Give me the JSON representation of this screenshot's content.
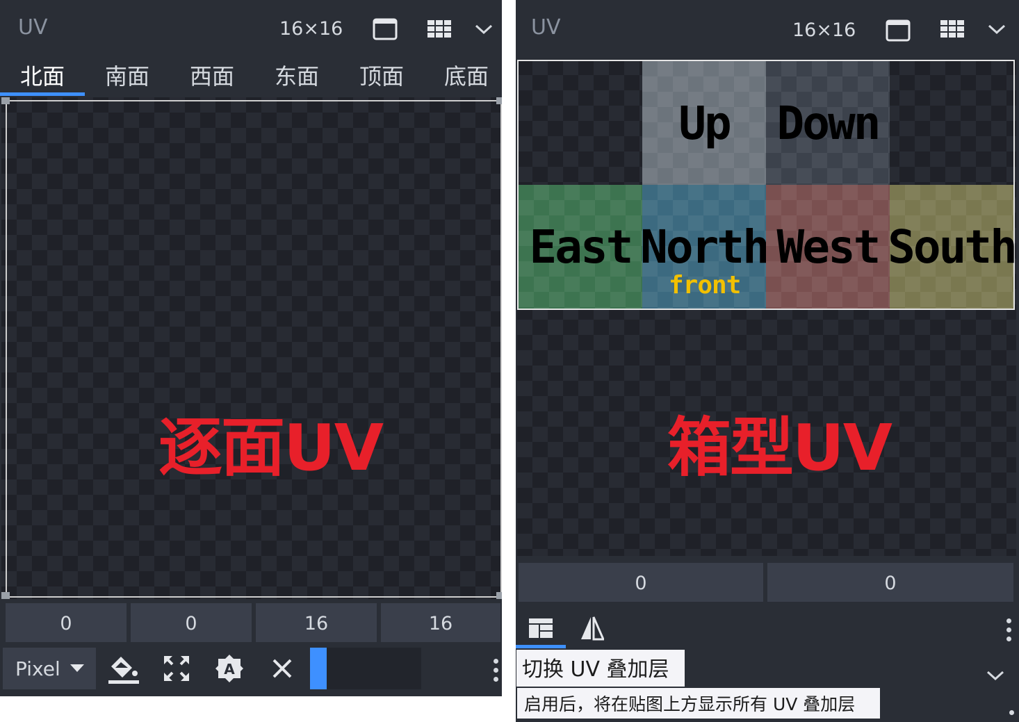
{
  "left": {
    "title": "UV",
    "size": "16×16",
    "tabs": [
      "北面",
      "南面",
      "西面",
      "东面",
      "顶面",
      "底面"
    ],
    "overlay_label": "逐面UV",
    "values": [
      "0",
      "0",
      "16",
      "16"
    ],
    "mode": "Pixel",
    "slider_fraction": 0.15,
    "icons": [
      "single-view-icon",
      "grid-view-icon",
      "chevron-down-icon",
      "fill-bucket-icon",
      "maximize-icon",
      "auto-uv-icon",
      "close-icon",
      "more-icon"
    ]
  },
  "right": {
    "title": "UV",
    "size": "16×16",
    "faces": [
      {
        "label": "Up",
        "color": "#6c747c"
      },
      {
        "label": "Down",
        "color": "#3c424c"
      },
      {
        "label": "East",
        "color": "#3d7450"
      },
      {
        "label": "North",
        "color": "#3c6a80",
        "sublabel": "front"
      },
      {
        "label": "West",
        "color": "#7a5050"
      },
      {
        "label": "South",
        "color": "#7a7850"
      }
    ],
    "overlay_label": "箱型UV",
    "values": [
      "0",
      "0"
    ],
    "tooltip_title": "切换 UV 叠加层",
    "tooltip_desc": "启用后，将在贴图上方显示所有 UV 叠加层",
    "icons": [
      "uv-overlay-icon",
      "mirror-icon",
      "more-icon",
      "chevron-down-icon"
    ]
  },
  "colors": {
    "accent": "#3e90ff",
    "label_red": "#e8202a",
    "front_yellow": "#f2c000"
  }
}
